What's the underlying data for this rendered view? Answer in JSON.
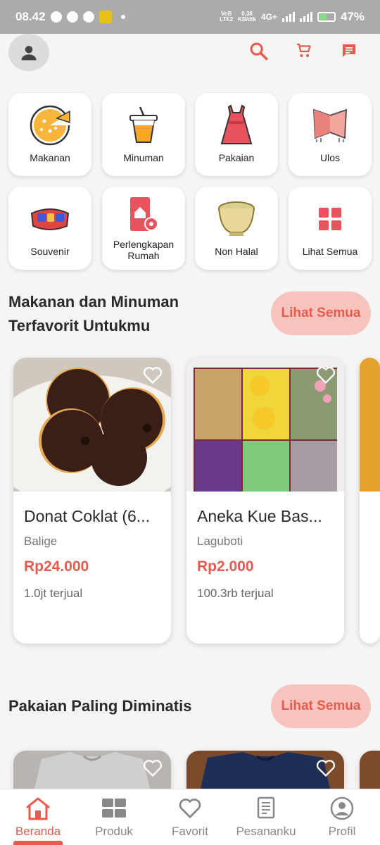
{
  "status_bar": {
    "time": "08.42",
    "network_lines": [
      "VoB",
      "LTE2"
    ],
    "speed_lines": [
      "0,38",
      "KB/dtk"
    ],
    "network_type": "4G+",
    "battery": "47%"
  },
  "header": {
    "icons": [
      "account-icon",
      "search-icon",
      "cart-icon",
      "chat-icon"
    ]
  },
  "categories": [
    {
      "label": "Makanan",
      "icon": "pizza-icon"
    },
    {
      "label": "Minuman",
      "icon": "drink-icon"
    },
    {
      "label": "Pakaian",
      "icon": "dress-icon"
    },
    {
      "label": "Ulos",
      "icon": "ulos-cloth-icon"
    },
    {
      "label": "Souvenir",
      "icon": "souvenir-icon"
    },
    {
      "label": "Perlengkapan",
      "label2": "Rumah",
      "icon": "home-device-icon"
    },
    {
      "label": "Non Halal",
      "icon": "bowl-icon"
    },
    {
      "label": "Lihat Semua",
      "icon": "grid-icon"
    }
  ],
  "section_favorites": {
    "title_line1": "Makanan dan Minuman",
    "title_line2": "Terfavorit Untukmu",
    "see_all": "Lihat Semua",
    "products": [
      {
        "name": "Donat Coklat (6...",
        "location": "Balige",
        "price": "Rp24.000",
        "sold": "1.0jt terjual"
      },
      {
        "name": "Aneka Kue Bas...",
        "location": "Laguboti",
        "price": "Rp2.000",
        "sold": "100.3rb terjual"
      }
    ]
  },
  "section_clothing": {
    "title": "Pakaian Paling Diminatis",
    "see_all": "Lihat Semua"
  },
  "bottom_nav": [
    {
      "label": "Beranda",
      "icon": "home-icon",
      "active": true
    },
    {
      "label": "Produk",
      "icon": "grid-icon",
      "active": false
    },
    {
      "label": "Favorit",
      "icon": "heart-icon",
      "active": false
    },
    {
      "label": "Pesananku",
      "icon": "receipt-icon",
      "active": false
    },
    {
      "label": "Profil",
      "icon": "profile-icon",
      "active": false
    }
  ],
  "colors": {
    "accent": "#e85a4b",
    "accent_light": "#f7c3bd",
    "status_bar": "#ababab"
  }
}
